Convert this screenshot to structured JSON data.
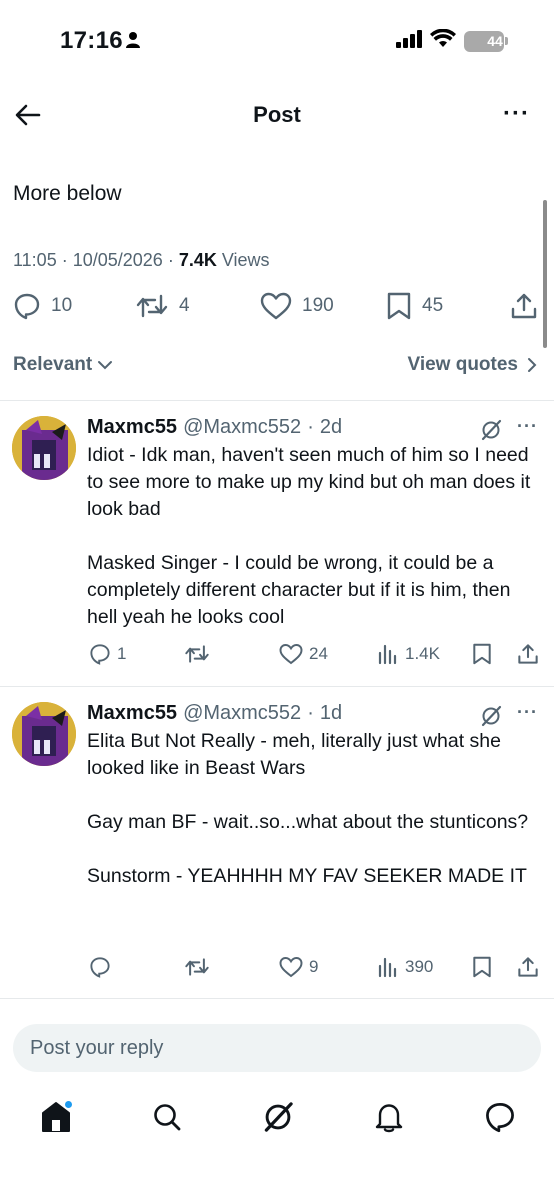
{
  "status_bar": {
    "time": "17:16",
    "battery": "44"
  },
  "header": {
    "title": "Post"
  },
  "post": {
    "text": "More below",
    "time": "11:05",
    "date": "10/05/2026",
    "views_count": "7.4K",
    "views_label": "Views",
    "replies": "10",
    "reposts": "4",
    "likes": "190",
    "bookmarks": "45"
  },
  "sort": {
    "label": "Relevant",
    "view_quotes": "View quotes"
  },
  "replies": [
    {
      "name": "Maxmc55",
      "handle": "@Maxmc552",
      "age": "2d",
      "body": "Idiot - Idk man, haven't seen much of him so I need to see more to make up my kind but oh man does it look bad\n\nMasked Singer - I could be wrong, it could be a completely different character but if it is him, then hell yeah he looks cool",
      "replies": "1",
      "reposts": "",
      "likes": "24",
      "views": "1.4K"
    },
    {
      "name": "Maxmc55",
      "handle": "@Maxmc552",
      "age": "1d",
      "body": "Elita But Not Really - meh, literally just what she looked like in Beast Wars\n\nGay man BF - wait..so...what about the stunticons?\n\nSunstorm - YEAHHHH MY FAV SEEKER MADE IT",
      "replies": "",
      "reposts": "",
      "likes": "9",
      "views": "390"
    }
  ],
  "reply_box": {
    "placeholder": "Post your reply"
  },
  "colors": {
    "accent": "#1d9bf0",
    "muted": "#536471",
    "text": "#0f1419"
  }
}
